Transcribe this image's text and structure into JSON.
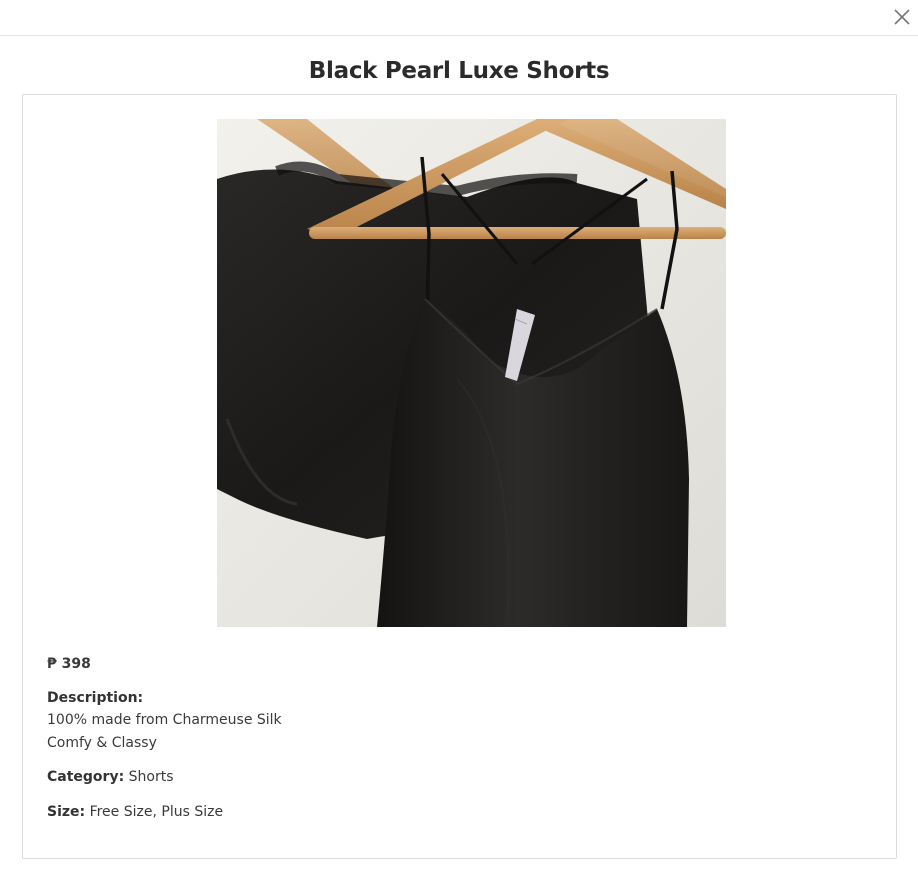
{
  "modal": {
    "title": "Black Pearl Luxe Shorts"
  },
  "product": {
    "image_alt": "Black Pearl Luxe Shorts",
    "price": "₱ 398",
    "description_label": "Description:",
    "description_lines": [
      "100% made from Charmeuse Silk",
      "Comfy & Classy"
    ],
    "category_label": "Category:",
    "category_value": "Shorts",
    "size_label": "Size:",
    "size_value": "Free Size, Plus Size"
  },
  "icons": {
    "close": "close-icon"
  },
  "colors": {
    "text": "#333333",
    "border": "#dcdcdc",
    "garment": "#1c1b1a",
    "hanger": "#c9955f"
  }
}
